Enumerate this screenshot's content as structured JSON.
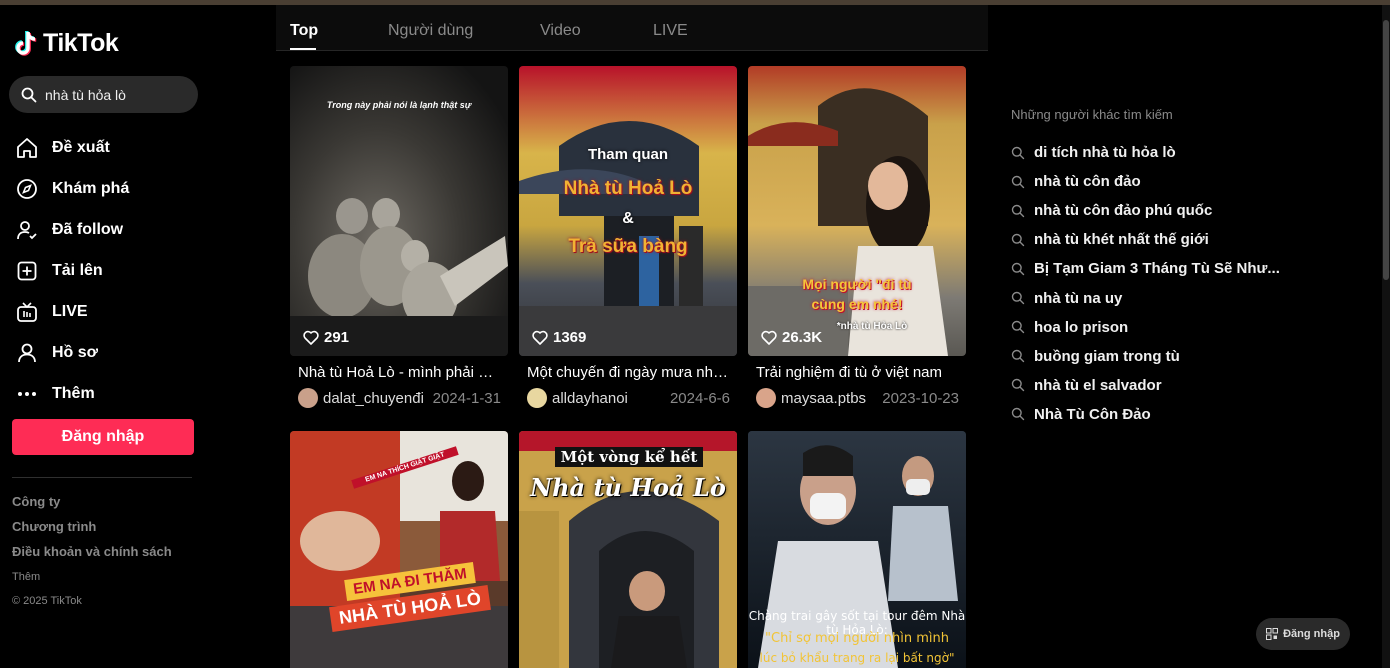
{
  "brand": {
    "name": "TikTok"
  },
  "search": {
    "value": "nhà tù hỏa lò"
  },
  "nav": [
    {
      "label": "Đề xuất",
      "icon": "home-icon"
    },
    {
      "label": "Khám phá",
      "icon": "compass-icon"
    },
    {
      "label": "Đã follow",
      "icon": "following-icon"
    },
    {
      "label": "Tải lên",
      "icon": "upload-icon"
    },
    {
      "label": "LIVE",
      "icon": "live-icon"
    },
    {
      "label": "Hồ sơ",
      "icon": "profile-icon"
    },
    {
      "label": "Thêm",
      "icon": "more-icon"
    }
  ],
  "sidebar": {
    "login_label": "Đăng nhập",
    "footer": [
      "Công ty",
      "Chương trình",
      "Điều khoản và chính sách"
    ],
    "footer_more": "Thêm",
    "copyright": "© 2025 TikTok"
  },
  "tabs": [
    "Top",
    "Người dùng",
    "Video",
    "LIVE"
  ],
  "active_tab": "Top",
  "videos": [
    {
      "likes": "291",
      "caption": "Nhà tù Hoả Lò - mình phải nói là lạnh thật sự",
      "author": "dalat_chuyenđi",
      "date": "2024-1-31",
      "overlay": "Trong này phải nói là lạnh thật sự"
    },
    {
      "likes": "1369",
      "caption": "Một chuyến đi ngày mưa như thế này",
      "author": "alldayhanoi",
      "date": "2024-6-6",
      "overlay": [
        "Tham quan",
        "Nhà tù Hoả Lò",
        "&",
        "Trà sữa bàng"
      ]
    },
    {
      "likes": "26.3K",
      "caption": "Trải nghiệm đi tù ở việt nam",
      "author": "maysaa.ptbs",
      "date": "2023-10-23",
      "overlay": [
        "Mọi người \"đi tù",
        "cùng em nhé!",
        "*nhà tù Hỏa Lò"
      ]
    },
    {
      "overlay": [
        "EM NA ĐI THĂM",
        "NHÀ TÙ HOẢ LÒ",
        "EM NA THÍCH GIẬT GIẬT"
      ]
    },
    {
      "overlay": [
        "Một vòng kể hết",
        "Nhà tù Hoả Lò"
      ]
    },
    {
      "overlay": [
        "Chàng trai gây sốt tại tour đêm Nhà tù Hỏa Lò:",
        "\"Chỉ sợ mọi người nhìn mình",
        "lúc bỏ khẩu trang ra lại bất ngờ\""
      ]
    }
  ],
  "related": {
    "title": "Những người khác tìm kiếm",
    "items": [
      "di tích nhà tù hỏa lò",
      "nhà tù côn đảo",
      "nhà tù côn đảo phú quốc",
      "nhà tù khét nhất thế giới",
      "Bị Tạm Giam 3 Tháng Tù Sẽ Như...",
      "nhà tù na uy",
      "hoa lo prison",
      "buồng giam trong tù",
      "nhà tù el salvador",
      "Nhà Tù Côn Đảo"
    ]
  },
  "float_login": "Đăng nhập",
  "colors": {
    "accent": "#fe2c55",
    "background": "#000000",
    "muted": "#8a8a8a"
  }
}
